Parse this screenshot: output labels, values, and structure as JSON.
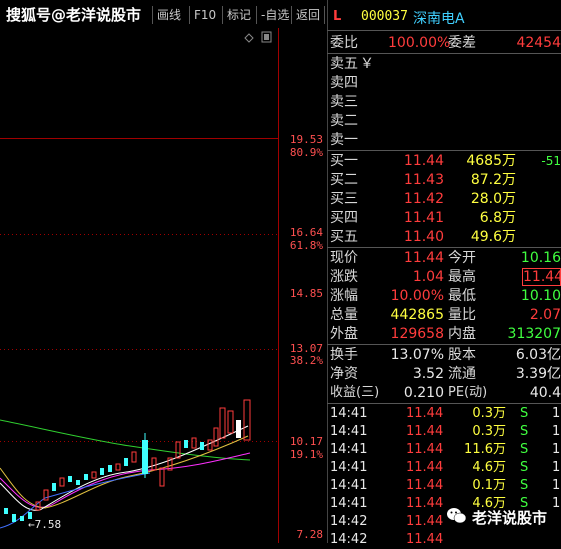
{
  "toolbar": {
    "watermark": "搜狐号@老洋说股市",
    "buttons": [
      "画线",
      "F10",
      "标记",
      "-自选",
      "返回"
    ]
  },
  "chart": {
    "price_labels": [
      "19.53",
      "16.64",
      "14.85",
      "13.07",
      "10.17",
      "7.28"
    ],
    "pct_labels": [
      "80.9%",
      "61.8%",
      "38.2%",
      "19.1%"
    ],
    "low_marker": "←7.58"
  },
  "header": {
    "mode": "L",
    "code": "000037",
    "name": "深南电A"
  },
  "weibi": {
    "label": "委比",
    "value": "100.00%",
    "label2": "委差",
    "value2": "42454"
  },
  "sell": [
    {
      "label": "卖五",
      "mark": "￥"
    },
    {
      "label": "卖四"
    },
    {
      "label": "卖三"
    },
    {
      "label": "卖二"
    },
    {
      "label": "卖一"
    }
  ],
  "buy": [
    {
      "label": "买一",
      "price": "11.44",
      "vol": "4685万",
      "chg": "-51"
    },
    {
      "label": "买二",
      "price": "11.43",
      "vol": "87.2万"
    },
    {
      "label": "买三",
      "price": "11.42",
      "vol": "28.0万"
    },
    {
      "label": "买四",
      "price": "11.41",
      "vol": "6.8万"
    },
    {
      "label": "买五",
      "price": "11.40",
      "vol": "49.6万"
    }
  ],
  "stats": [
    {
      "l1": "现价",
      "v1": "11.44",
      "c1": "red",
      "l2": "今开",
      "v2": "10.16",
      "c2": "grn"
    },
    {
      "l1": "涨跌",
      "v1": "1.04",
      "c1": "red",
      "l2": "最高",
      "v2": "11.44",
      "c2": "red"
    },
    {
      "l1": "涨幅",
      "v1": "10.00%",
      "c1": "red",
      "l2": "最低",
      "v2": "10.10",
      "c2": "grn"
    },
    {
      "l1": "总量",
      "v1": "442865",
      "c1": "yel",
      "l2": "量比",
      "v2": "2.07",
      "c2": "red"
    },
    {
      "l1": "外盘",
      "v1": "129658",
      "c1": "red",
      "l2": "内盘",
      "v2": "313207",
      "c2": "grn"
    }
  ],
  "fund": [
    {
      "l1": "换手",
      "v1": "13.07%",
      "l2": "股本",
      "v2": "6.03亿"
    },
    {
      "l1": "净资",
      "v1": "3.52",
      "l2": "流通",
      "v2": "3.39亿"
    },
    {
      "l1": "收益(三)",
      "v1": "0.210",
      "l2": "PE(动)",
      "v2": "40.4"
    }
  ],
  "ticks": [
    {
      "time": "14:41",
      "price": "11.44",
      "vol": "0.3万",
      "side": "S",
      "n": "1"
    },
    {
      "time": "14:41",
      "price": "11.44",
      "vol": "0.3万",
      "side": "S",
      "n": "1"
    },
    {
      "time": "14:41",
      "price": "11.44",
      "vol": "11.6万",
      "side": "S",
      "n": "1"
    },
    {
      "time": "14:41",
      "price": "11.44",
      "vol": "4.6万",
      "side": "S",
      "n": "1"
    },
    {
      "time": "14:41",
      "price": "11.44",
      "vol": "0.1万",
      "side": "S",
      "n": "1"
    },
    {
      "time": "14:41",
      "price": "11.44",
      "vol": "4.6万",
      "side": "S",
      "n": "1"
    },
    {
      "time": "14:42",
      "price": "11.44",
      "vol": "",
      "side": "",
      "n": ""
    },
    {
      "time": "14:42",
      "price": "11.44",
      "vol": "",
      "side": "",
      "n": ""
    }
  ],
  "bottom_watermark": "老洋说股市",
  "colors": {
    "up": "#ff3c3c",
    "down": "#40ffff",
    "bg": "#000000"
  }
}
